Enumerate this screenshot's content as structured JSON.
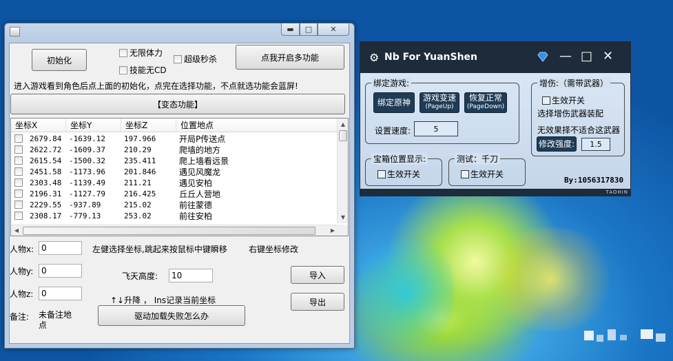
{
  "main_window": {
    "min_glyph": "▬",
    "max_glyph": "□",
    "close_glyph": "✕",
    "init_button": "初始化",
    "cb_infinite_stamina": "无限体力",
    "cb_skill_no_cd": "技能无CD",
    "cb_super_kill": "超级秒杀",
    "multi_function_button": "点我开启多功能",
    "warning_text": "进入游戏看到角色后点上面的初始化，点完在选择功能，不点就选功能会蓝屏!",
    "abnormal_button": "【变态功能】",
    "table": {
      "headers": [
        "坐标X",
        "坐标Y",
        "坐标Z",
        "位置地点"
      ],
      "rows": [
        {
          "x": "2679.84",
          "y": "-1639.12",
          "z": "197.966",
          "place": "开局P传送点"
        },
        {
          "x": "2622.72",
          "y": "-1609.37",
          "z": "210.29",
          "place": "爬墙的地方"
        },
        {
          "x": "2615.54",
          "y": "-1500.32",
          "z": "235.411",
          "place": "爬上墙看远景"
        },
        {
          "x": "2451.58",
          "y": "-1173.96",
          "z": "201.846",
          "place": "遇见风魔龙"
        },
        {
          "x": "2303.48",
          "y": "-1139.49",
          "z": "211.21",
          "place": "遇见安柏"
        },
        {
          "x": "2196.31",
          "y": "-1127.79",
          "z": "216.425",
          "place": "丘丘人营地"
        },
        {
          "x": "2229.55",
          "y": "-937.89",
          "z": "215.02",
          "place": "前往蒙德"
        },
        {
          "x": "2308.17",
          "y": "-779.13",
          "z": "253.02",
          "place": "前往安柏"
        }
      ]
    },
    "char_x_label": "人物x:",
    "char_x_value": "0",
    "char_y_label": "人物y:",
    "char_y_value": "0",
    "char_z_label": "人物z:",
    "char_z_value": "0",
    "note_label": "备注:",
    "note_value": "未备注地点",
    "hint_left_click": "左健选择坐标,跳起来按鼠标中键瞬移",
    "hint_right_click": "右键坐标修改",
    "fly_height_label": "飞天高度:",
    "fly_height_value": "10",
    "updown_hint": "↑↓升降 ， Ins记录当前坐标",
    "driver_fail_button": "驱动加载失败怎么办",
    "import_button": "导入",
    "export_button": "导出"
  },
  "yuanshen_app": {
    "title": "Nb For YuanShen",
    "gear_icon": "⚙",
    "gem_icon": "gem-icon",
    "min_glyph": "—",
    "max_glyph": "□",
    "close_glyph": "✕",
    "bind_group_title": "绑定游戏:",
    "bind_button": "绑定原神",
    "speed_button_line1": "游戏变速",
    "speed_button_line2": "(PageUp)",
    "restore_button_line1": "恢复正常",
    "restore_button_line2": "(PageDown)",
    "speed_label": "设置速度:",
    "speed_value": "5",
    "dmg_group_title": "增伤:（需带武器）",
    "dmg_enable": "生效开关",
    "dmg_hint1": "选择增伤武器装配",
    "dmg_hint2": "无效果择不适合这武器",
    "modify_strength_button": "修改强度:",
    "strength_value": "1.5",
    "chest_group_title": "宝箱位置显示:",
    "chest_enable": "生效开关",
    "test_group_title": "测试：千刀",
    "test_enable": "生效开关",
    "author": "By:1056317830",
    "footer": "TAOHIN",
    "colors": {
      "header": "#1d2b3a",
      "button": "#1f3b56"
    }
  }
}
